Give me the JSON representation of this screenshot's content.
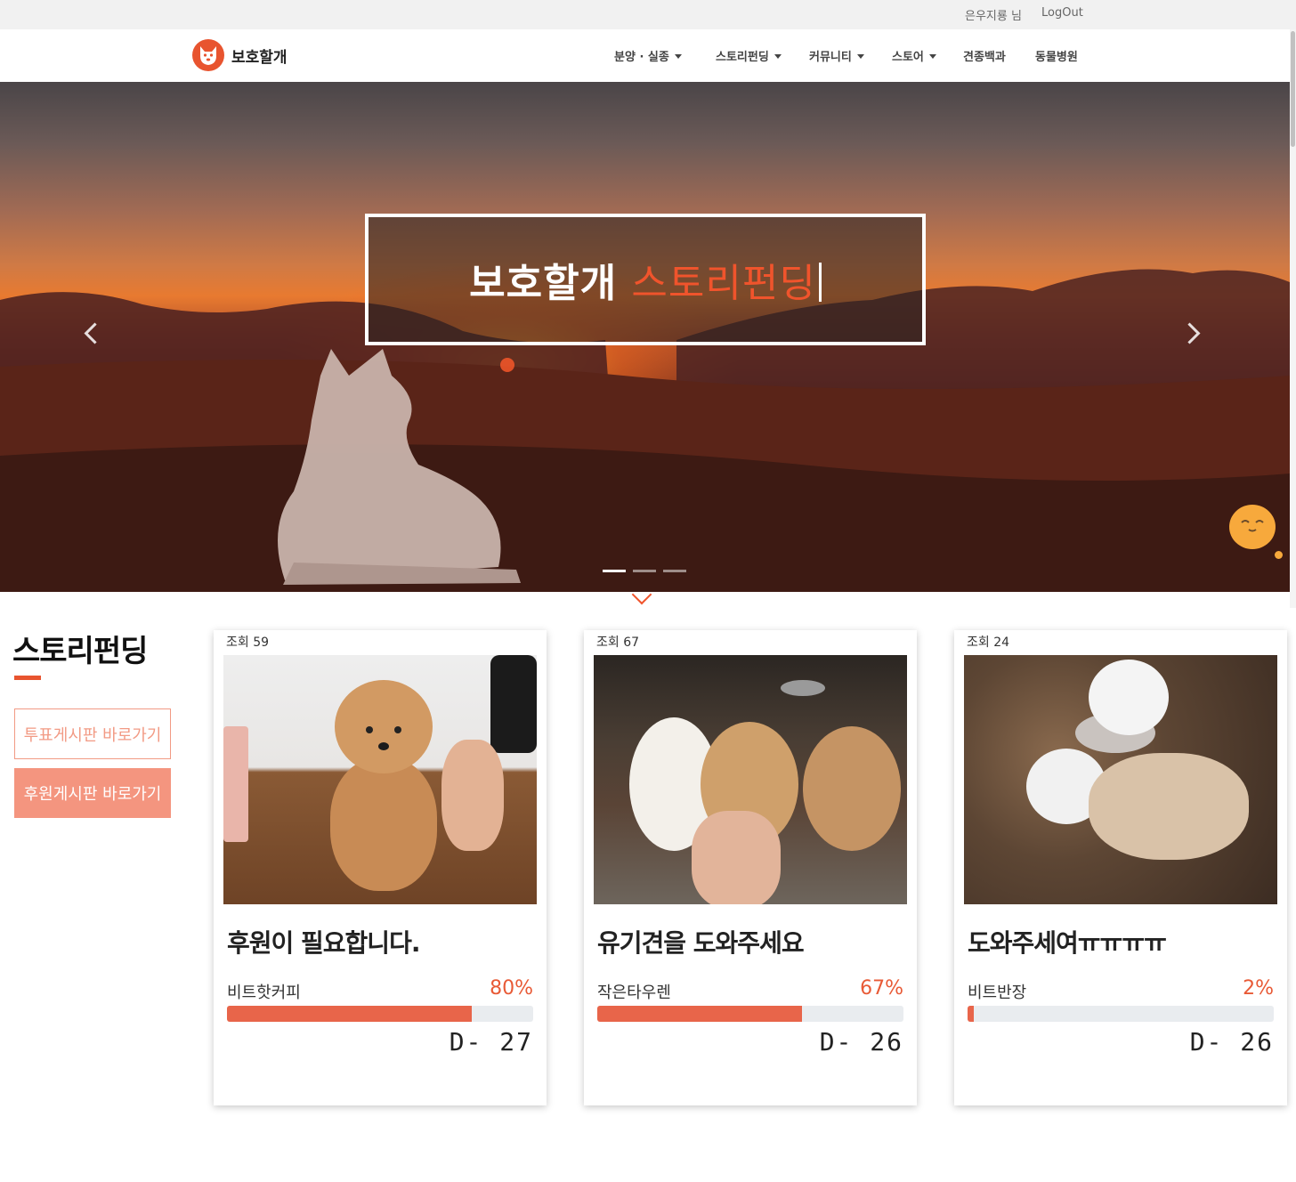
{
  "topbar": {
    "user": "은우지룡 님",
    "logout": "LogOut"
  },
  "brand": {
    "name": "보호할개"
  },
  "nav": [
    {
      "label": "분양 · 실종",
      "dropdown": true
    },
    {
      "label": "스토리펀딩",
      "dropdown": true
    },
    {
      "label": "커뮤니티",
      "dropdown": true
    },
    {
      "label": "스토어",
      "dropdown": true
    },
    {
      "label": "견종백과",
      "dropdown": false
    },
    {
      "label": "동물병원",
      "dropdown": false
    }
  ],
  "hero": {
    "headline_main": "보호할개",
    "headline_accent": "스토리펀딩",
    "slides": 3,
    "active_slide": 1
  },
  "section": {
    "title": "스토리펀딩",
    "btn_vote": "투표게시판 바로가기",
    "btn_support": "후원게시판 바로가기"
  },
  "cards": [
    {
      "views": "조회 59",
      "title": "후원이 필요합니다.",
      "item": "비트핫커피",
      "percent_label": "80%",
      "percent": 80,
      "dday": "D- 27"
    },
    {
      "views": "조회 67",
      "title": "유기견을 도와주세요",
      "item": "작은타우렌",
      "percent_label": "67%",
      "percent": 67,
      "dday": "D- 26"
    },
    {
      "views": "조회 24",
      "title": "도와주세여ㅠㅠㅠㅠ",
      "item": "비트반장",
      "percent_label": "2%",
      "percent": 2,
      "dday": "D- 26"
    }
  ],
  "colors": {
    "accent": "#e8542f",
    "button_fill": "#f4957f",
    "progress": "#e8654a"
  }
}
